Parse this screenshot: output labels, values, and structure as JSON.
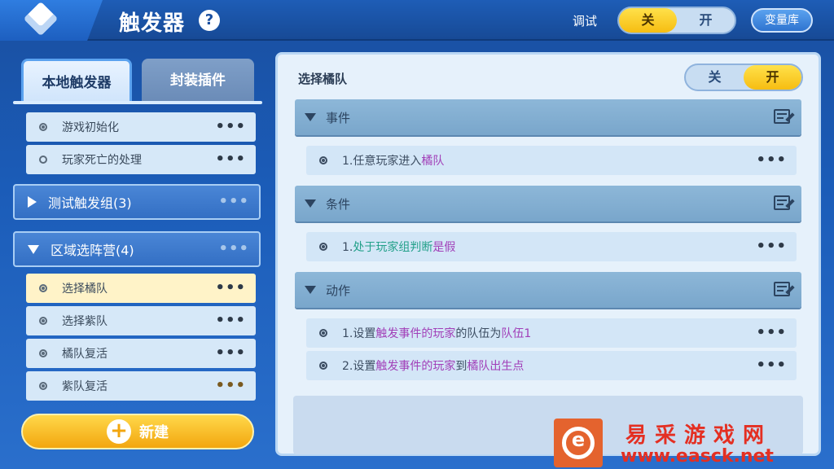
{
  "header": {
    "title": "触发器",
    "help": "?",
    "debug_label": "调试",
    "debug_off": "关",
    "debug_on": "开",
    "debug_state": "关",
    "var_library": "变量库"
  },
  "tabs": [
    {
      "label": "本地触发器",
      "active": true
    },
    {
      "label": "封装插件",
      "active": false
    }
  ],
  "triggers": {
    "top_items": [
      {
        "label": "游戏初始化",
        "more": "•••"
      },
      {
        "label": "玩家死亡的处理",
        "more": "•••"
      }
    ],
    "groups": [
      {
        "label": "测试触发组(3)",
        "more": "•••",
        "expanded": false
      },
      {
        "label": "区域选阵营(4)",
        "more": "•••",
        "expanded": true
      }
    ],
    "group_items": [
      {
        "label": "选择橘队",
        "more": "•••",
        "selected": true
      },
      {
        "label": "选择紫队",
        "more": "•••",
        "selected": false
      },
      {
        "label": "橘队复活",
        "more": "•••",
        "selected": false
      },
      {
        "label": "紫队复活",
        "more": "•••",
        "selected": false
      }
    ]
  },
  "new_button": "新建",
  "detail": {
    "title": "选择橘队",
    "toggle_off": "关",
    "toggle_on": "开",
    "toggle_state": "开",
    "sections": {
      "event": {
        "label": "事件",
        "rows": [
          {
            "prefix": "1.任意玩家进入",
            "kw1": "橘队"
          }
        ]
      },
      "condition": {
        "label": "条件",
        "rows": [
          {
            "prefix": "1.",
            "kw1": "处于玩家组判断",
            "suffix": "是假"
          }
        ]
      },
      "action": {
        "label": "动作",
        "rows": [
          {
            "prefix": "1.设置",
            "kw1": "触发事件的玩家",
            "mid": "的队伍为",
            "kw2": "队伍1"
          },
          {
            "prefix": "2.设置",
            "kw1": "触发事件的玩家",
            "mid": "到",
            "kw2": "橘队出生点"
          }
        ]
      }
    },
    "more": "•••"
  },
  "watermark": {
    "logo_letter": "e",
    "name": "易采游戏网",
    "url": "www.easck.net"
  },
  "colors": {
    "accent_yellow": "#f6bd12",
    "keyword_purple": "#a13fb8",
    "keyword_green": "#23a08a",
    "selected_row": "#fff3c8"
  }
}
